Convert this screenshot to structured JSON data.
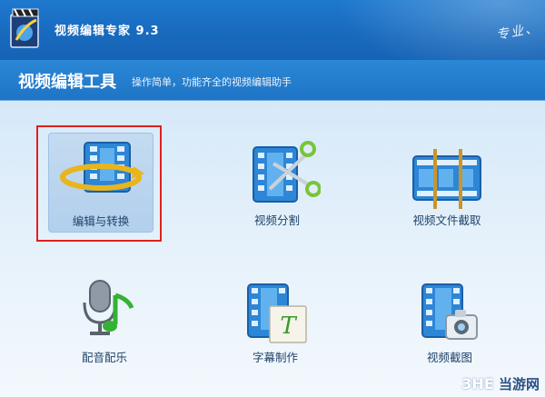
{
  "app": {
    "title": "视频编辑专家 9.3",
    "slogan": "专业、"
  },
  "header": {
    "title": "视频编辑工具",
    "description": "操作简单，功能齐全的视频编辑助手"
  },
  "tools": [
    {
      "label": "编辑与转换",
      "icon": "film-convert-icon"
    },
    {
      "label": "视频分割",
      "icon": "film-scissors-icon"
    },
    {
      "label": "视频文件截取",
      "icon": "film-trim-icon"
    },
    {
      "label": "配音配乐",
      "icon": "microphone-music-icon"
    },
    {
      "label": "字幕制作",
      "icon": "film-subtitle-icon"
    },
    {
      "label": "视频截图",
      "icon": "film-camera-icon"
    }
  ],
  "selected_tool": "编辑与转换",
  "watermark": {
    "brand": "3HE",
    "text": "当游网"
  },
  "colors": {
    "titlebar": "#1869bd",
    "header": "#1f74c5",
    "selection": "#e02020",
    "label": "#21436b"
  }
}
